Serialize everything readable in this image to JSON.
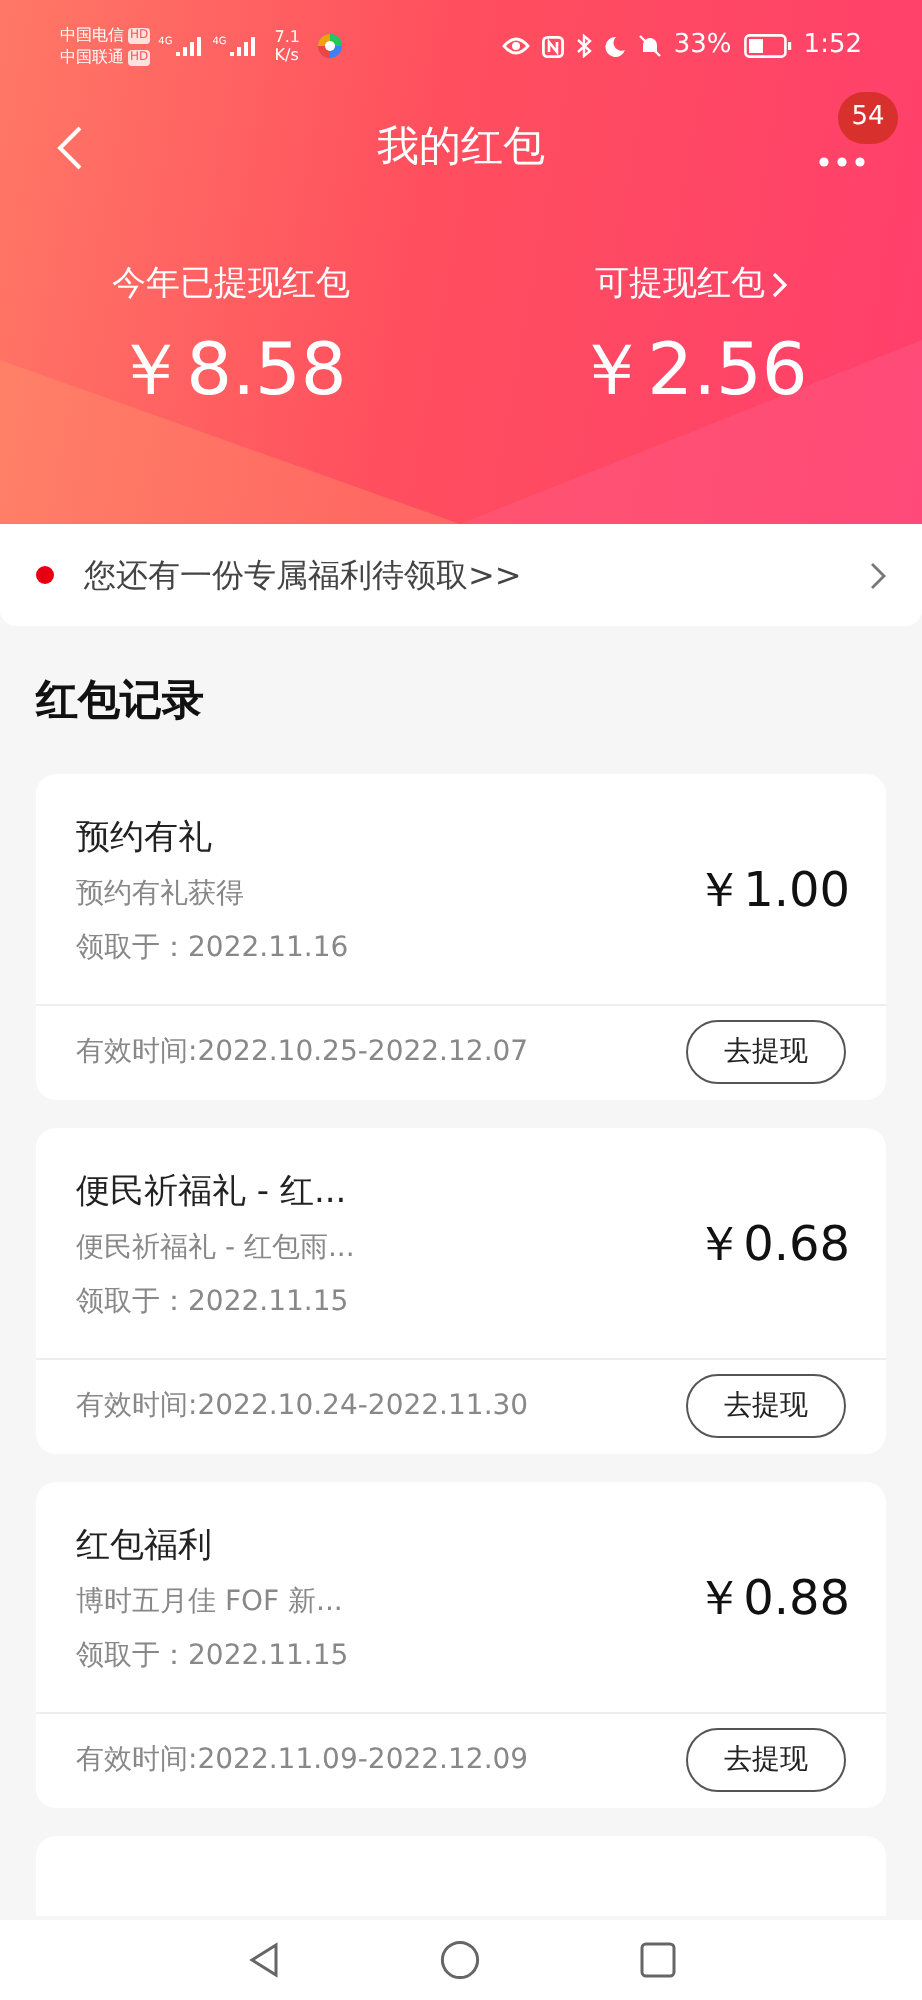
{
  "status_bar": {
    "carriers": [
      {
        "name": "中国电信",
        "badge": "HD",
        "network": "4G"
      },
      {
        "name": "中国联通",
        "badge": "HD",
        "network": "4G"
      }
    ],
    "speed": "7.1",
    "speed_unit": "K/s",
    "battery": "33%",
    "time": "1:52"
  },
  "header": {
    "title": "我的红包",
    "notification_count": "54"
  },
  "stats": [
    {
      "label": "今年已提现红包",
      "amount": "￥8.58",
      "link": false
    },
    {
      "label": "可提现红包",
      "amount": "￥2.56",
      "link": true
    }
  ],
  "banner": {
    "text": "您还有一份专属福利待领取>>"
  },
  "section_title": "红包记录",
  "records": [
    {
      "title": "预约有礼",
      "subtitle": "预约有礼获得",
      "date": "领取于：2022.11.16",
      "amount": "￥1.00",
      "validity": "有效时间:2022.10.25-2022.12.07",
      "button": "去提现"
    },
    {
      "title": "便民祈福礼 - 红...",
      "subtitle": "便民祈福礼 - 红包雨...",
      "date": "领取于：2022.11.15",
      "amount": "￥0.68",
      "validity": "有效时间:2022.10.24-2022.11.30",
      "button": "去提现"
    },
    {
      "title": "红包福利",
      "subtitle": "博时五月佳 FOF 新...",
      "date": "领取于：2022.11.15",
      "amount": "￥0.88",
      "validity": "有效时间:2022.11.09-2022.12.09",
      "button": "去提现"
    }
  ]
}
